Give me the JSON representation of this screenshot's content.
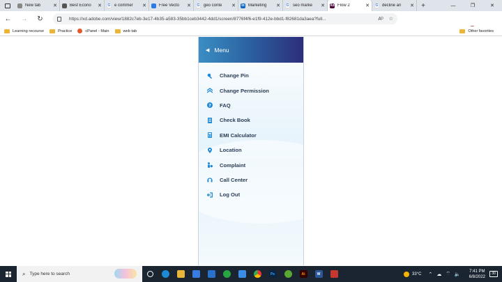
{
  "browser": {
    "tabs": [
      {
        "title": "New tab",
        "color": "#888888",
        "glyph": ""
      },
      {
        "title": "Best Econo",
        "color": "#555555",
        "glyph": ""
      },
      {
        "title": "e commer",
        "color": "#ffffff",
        "glyph": "G"
      },
      {
        "title": "Free Vecto",
        "color": "#2d7be5",
        "glyph": ""
      },
      {
        "title": "geo conte",
        "color": "#ffffff",
        "glyph": "G"
      },
      {
        "title": "Marketing",
        "color": "#0a66c2",
        "glyph": "in"
      },
      {
        "title": "seo marke",
        "color": "#ffffff",
        "glyph": "G"
      },
      {
        "title": "Flow 2",
        "color": "#470137",
        "glyph": "Xd",
        "active": true
      },
      {
        "title": "decline an",
        "color": "#ffffff",
        "glyph": "G"
      }
    ],
    "url": "https://xd.adobe.com/view/1882c7eb-3e17-4b35-a583-35bb1ceb3442-4dd1/screen/8776f4f6-e1f9-412e-bbd1-f82681da3aea?full...",
    "bookmarks": [
      {
        "label": "Learning recourse",
        "icon": "folder"
      },
      {
        "label": "Practice",
        "icon": "folder"
      },
      {
        "label": "cPanel - Main",
        "icon": "cpanel"
      },
      {
        "label": "web tab",
        "icon": "folder"
      }
    ],
    "other_bookmarks": "Other favorites"
  },
  "app": {
    "menu_title": "Menu",
    "accent_color": "#2b5f9e",
    "icon_color": "#1e88d9",
    "items": [
      {
        "label": "Change Pin",
        "icon": "key-icon"
      },
      {
        "label": "Change Permission",
        "icon": "permission-icon"
      },
      {
        "label": "FAQ",
        "icon": "question-icon"
      },
      {
        "label": "Check Book",
        "icon": "checkbook-icon"
      },
      {
        "label": "EMI Calculator",
        "icon": "calculator-icon"
      },
      {
        "label": "Location",
        "icon": "location-pin-icon"
      },
      {
        "label": "Complaint",
        "icon": "complaint-icon"
      },
      {
        "label": "Call Center",
        "icon": "headset-icon"
      },
      {
        "label": "Log Out",
        "icon": "logout-icon"
      }
    ]
  },
  "taskbar": {
    "search_placeholder": "Type here to search",
    "temperature": "33°C",
    "time": "7:41 PM",
    "date": "6/8/2022",
    "notifications": "30"
  }
}
